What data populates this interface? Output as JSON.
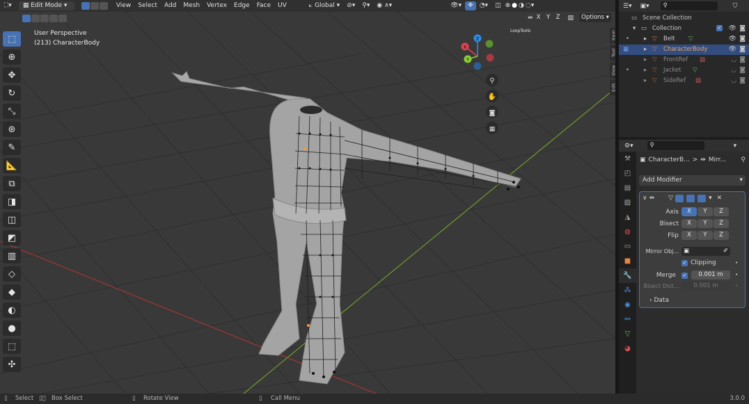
{
  "header": {
    "mode": "Edit Mode",
    "menus": [
      "View",
      "Select",
      "Add",
      "Mesh",
      "Vertex",
      "Edge",
      "Face",
      "UV"
    ],
    "transform_orientation": "Global",
    "mirror_axes": [
      "X",
      "Y",
      "Z"
    ],
    "options_label": "Options"
  },
  "viewport": {
    "perspective_label": "User Perspective",
    "object_label": "(213) CharacterBody",
    "loop_tools_label": "LoopTools",
    "gizmo_axes": {
      "x": "X",
      "y": "Y",
      "z": "Z"
    },
    "colors": {
      "x": "#e0444e",
      "y": "#8bcf34",
      "z": "#2e8fe8",
      "grid_x": "#c33a3a",
      "grid_y": "#6f9c2b"
    }
  },
  "sidebar_tabs": [
    "Item",
    "Tool",
    "View",
    "Edit"
  ],
  "outliner": {
    "search_placeholder": "",
    "scene_collection": "Scene Collection",
    "collection": "Collection",
    "items": [
      {
        "name": "Belt",
        "selected": false
      },
      {
        "name": "CharacterBody",
        "selected": true
      },
      {
        "name": "FrontRef",
        "selected": false
      },
      {
        "name": "Jacket",
        "selected": false
      },
      {
        "name": "SideRef",
        "selected": false
      }
    ]
  },
  "properties": {
    "breadcrumb_object": "CharacterB...",
    "breadcrumb_sep": ">",
    "breadcrumb_modifier": "Mirr...",
    "add_modifier": "Add Modifier",
    "axis_label": "Axis",
    "bisect_label": "Bisect",
    "flip_label": "Flip",
    "axes": [
      "X",
      "Y",
      "Z"
    ],
    "mirror_object_label": "Mirror Obj...",
    "clipping_label": "Clipping",
    "merge_label": "Merge",
    "merge_value": "0.001 m",
    "bisect_distance_label": "Bisect Dist...",
    "bisect_distance_value": "0.001 m",
    "data_label": "Data"
  },
  "statusbar": {
    "select": "Select",
    "box_select": "Box Select",
    "rotate_view": "Rotate View",
    "call_menu": "Call Menu",
    "version": "3.0.0"
  }
}
